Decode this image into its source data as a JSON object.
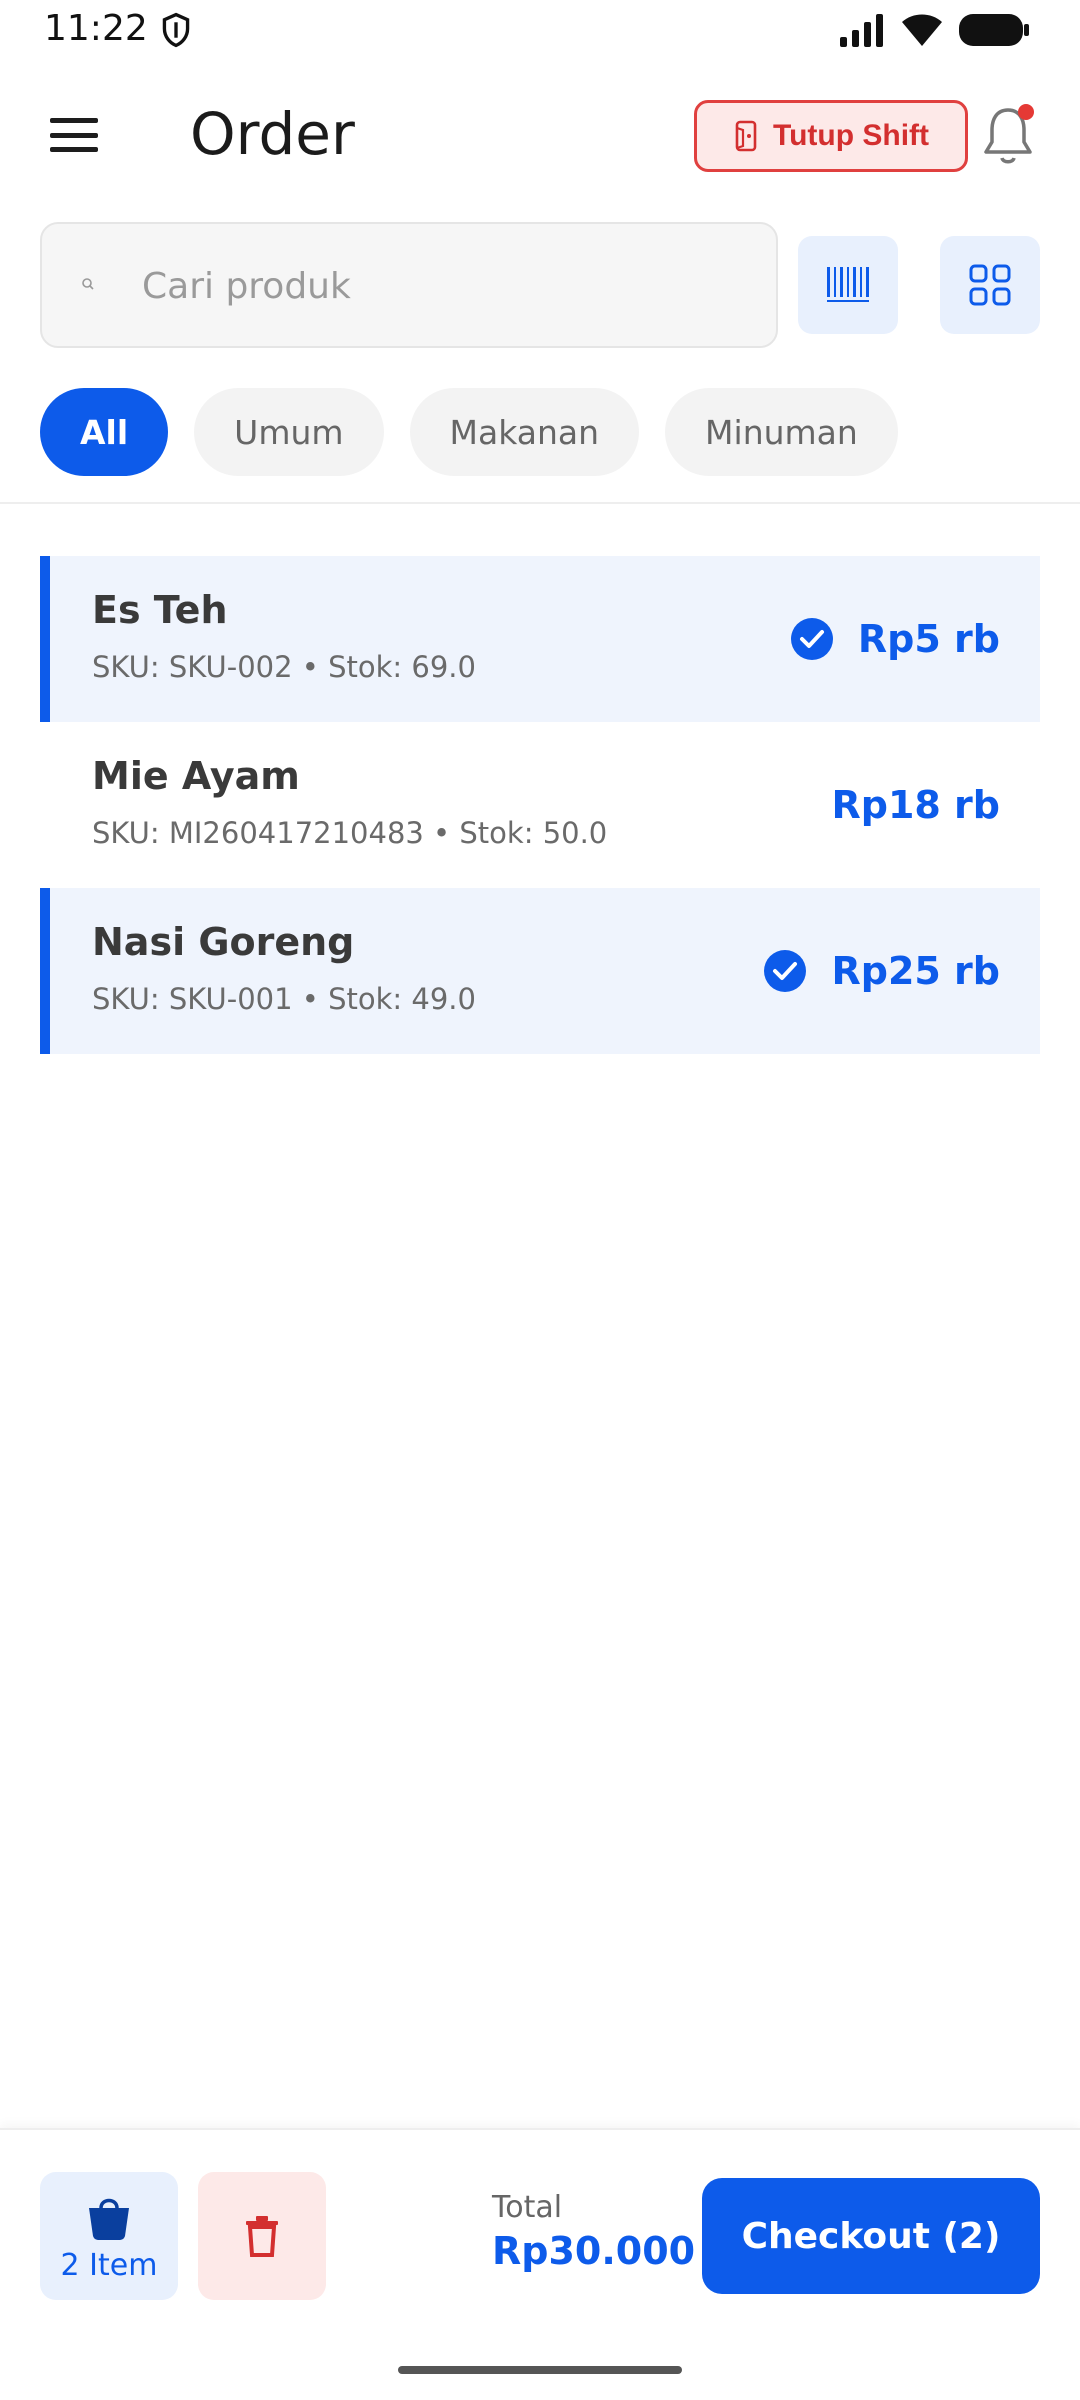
{
  "status_bar": {
    "time": "11:22"
  },
  "app_bar": {
    "title": "Order",
    "shift_button_label": "Tutup Shift",
    "notification_dot": true
  },
  "search": {
    "placeholder": "Cari produk"
  },
  "categories": [
    {
      "label": "All",
      "active": true
    },
    {
      "label": "Umum",
      "active": false
    },
    {
      "label": "Makanan",
      "active": false
    },
    {
      "label": "Minuman",
      "active": false
    }
  ],
  "products": [
    {
      "name": "Es Teh",
      "meta": "SKU: SKU-002 • Stok: 69.0",
      "price": "Rp5 rb",
      "selected": true
    },
    {
      "name": "Mie Ayam",
      "meta": "SKU: MI260417210483 • Stok: 50.0",
      "price": "Rp18 rb",
      "selected": false
    },
    {
      "name": "Nasi Goreng",
      "meta": "SKU: SKU-001 • Stok: 49.0",
      "price": "Rp25 rb",
      "selected": true
    }
  ],
  "bottom_bar": {
    "cart_label": "2 Item",
    "total_label": "Total",
    "total_value": "Rp30.000",
    "checkout_label": "Checkout (2)"
  },
  "colors": {
    "accent": "#0d5bea",
    "danger": "#d32f2f",
    "selected_bg": "#eff4fd"
  }
}
